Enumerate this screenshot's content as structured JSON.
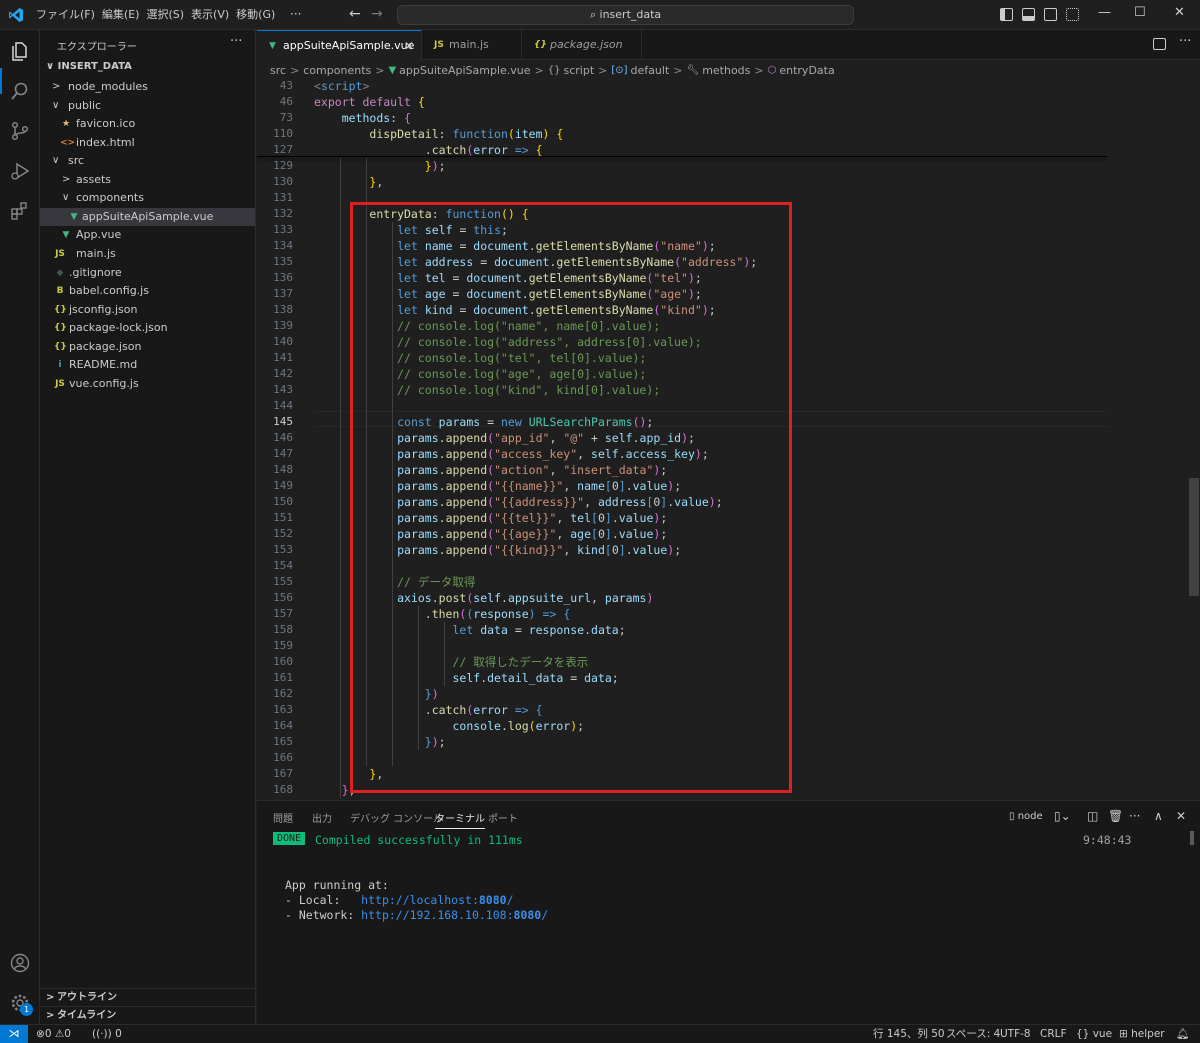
{
  "titlebar": {
    "menus": [
      "ファイル(F)",
      "編集(E)",
      "選択(S)",
      "表示(V)",
      "移動(G)"
    ],
    "more": "···",
    "search": "insert_data",
    "controls": [
      "—",
      "☐",
      "✕"
    ]
  },
  "sidebar": {
    "title": "エクスプローラー",
    "more": "···",
    "root": "INSERT_DATA",
    "items": [
      {
        "label": "node_modules",
        "chevron": ">",
        "icon": "",
        "icon_name": "folder-icon"
      },
      {
        "label": "public",
        "chevron": "∨",
        "icon": "",
        "icon_name": "folder-open-icon"
      },
      {
        "label": "favicon.ico",
        "chevron": "",
        "icon": "★",
        "icon_name": "favicon-file-icon"
      },
      {
        "label": "index.html",
        "chevron": "",
        "icon": "<>",
        "icon_name": "html-file-icon"
      },
      {
        "label": "src",
        "chevron": "∨",
        "icon": "",
        "icon_name": "folder-open-icon"
      },
      {
        "label": "assets",
        "chevron": ">",
        "icon": "",
        "icon_name": "folder-icon"
      },
      {
        "label": "components",
        "chevron": "∨",
        "icon": "",
        "icon_name": "folder-open-icon"
      },
      {
        "label": "appSuiteApiSample.vue",
        "chevron": "",
        "icon": "▼",
        "icon_name": "vue-file-icon"
      },
      {
        "label": "App.vue",
        "chevron": "",
        "icon": "▼",
        "icon_name": "vue-file-icon"
      },
      {
        "label": "main.js",
        "chevron": "",
        "icon": "JS",
        "icon_name": "js-file-icon"
      },
      {
        "label": ".gitignore",
        "chevron": "",
        "icon": "◆",
        "icon_name": "git-file-icon"
      },
      {
        "label": "babel.config.js",
        "chevron": "",
        "icon": "B",
        "icon_name": "babel-file-icon"
      },
      {
        "label": "jsconfig.json",
        "chevron": "",
        "icon": "{}",
        "icon_name": "json-file-icon"
      },
      {
        "label": "package-lock.json",
        "chevron": "",
        "icon": "{}",
        "icon_name": "json-file-icon"
      },
      {
        "label": "package.json",
        "chevron": "",
        "icon": "{}",
        "icon_name": "json-file-icon"
      },
      {
        "label": "README.md",
        "chevron": "",
        "icon": "i",
        "icon_name": "info-file-icon"
      },
      {
        "label": "vue.config.js",
        "chevron": "",
        "icon": "JS",
        "icon_name": "js-file-icon"
      }
    ],
    "outline": "アウトライン",
    "timeline": "タイムライン"
  },
  "tabs": [
    {
      "label": "appSuiteApiSample.vue",
      "icon": "▼",
      "close": "✕"
    },
    {
      "label": "main.js",
      "icon": "JS"
    },
    {
      "label": "package.json",
      "icon": "{}"
    }
  ],
  "breadcrumb": [
    "src",
    "components",
    "appSuiteApiSample.vue",
    "script",
    "default",
    "methods",
    "entryData"
  ],
  "editor": {
    "sticky_lines": [
      "43",
      "46",
      "73",
      "110",
      "127"
    ],
    "line_numbers": [
      "129",
      "130",
      "131",
      "132",
      "133",
      "134",
      "135",
      "136",
      "137",
      "138",
      "139",
      "140",
      "141",
      "142",
      "143",
      "144",
      "145",
      "146",
      "147",
      "148",
      "149",
      "150",
      "151",
      "152",
      "153",
      "154",
      "155",
      "156",
      "157",
      "158",
      "159",
      "160",
      "161",
      "162",
      "163",
      "164",
      "165",
      "166",
      "167",
      "168"
    ],
    "current_line": "145"
  },
  "panel": {
    "tabs": [
      "問題",
      "出力",
      "デバッグ コンソール",
      "ターミナル",
      "ポート"
    ],
    "terminal_name": "node",
    "done": "DONE",
    "compiled": "Compiled successfully in 111ms",
    "time": "9:48:43",
    "running": "App running at:",
    "local_label": "- Local:   ",
    "local_url": "http://localhost:",
    "local_port": "8080",
    "network_label": "- Network: ",
    "network_url": "http://192.168.10.108:",
    "network_port": "8080",
    "slash": "/"
  },
  "statusbar": {
    "errors": "0",
    "warnings": "0",
    "ports": "0",
    "position": "行 145、列 50",
    "spaces": "スペース: 4",
    "encoding": "UTF-8",
    "eol": "CRLF",
    "language": "vue",
    "helper": "helper",
    "notifications_badge": "1"
  }
}
